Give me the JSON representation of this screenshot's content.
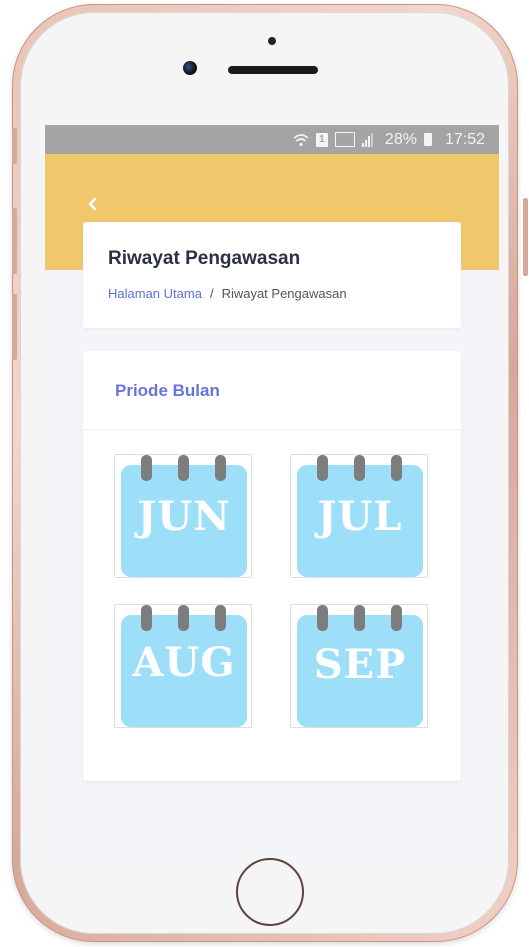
{
  "status_bar": {
    "battery": "28%",
    "time": "17:52",
    "sim_label": "1"
  },
  "header": {
    "back_icon": "chevron-left-icon"
  },
  "title_card": {
    "title": "Riwayat Pengawasan",
    "breadcrumb_home": "Halaman Utama",
    "breadcrumb_separator": "/",
    "breadcrumb_current": "Riwayat Pengawasan"
  },
  "period_card": {
    "title": "Priode Bulan",
    "months": [
      {
        "label": "JUN"
      },
      {
        "label": "JUL"
      },
      {
        "label": "AUG"
      },
      {
        "label": "SEP"
      }
    ]
  },
  "colors": {
    "header": "#f0c76a",
    "accent": "#6a74d8",
    "calendar": "#9ddff8",
    "status_bar": "#a4a4a4"
  }
}
